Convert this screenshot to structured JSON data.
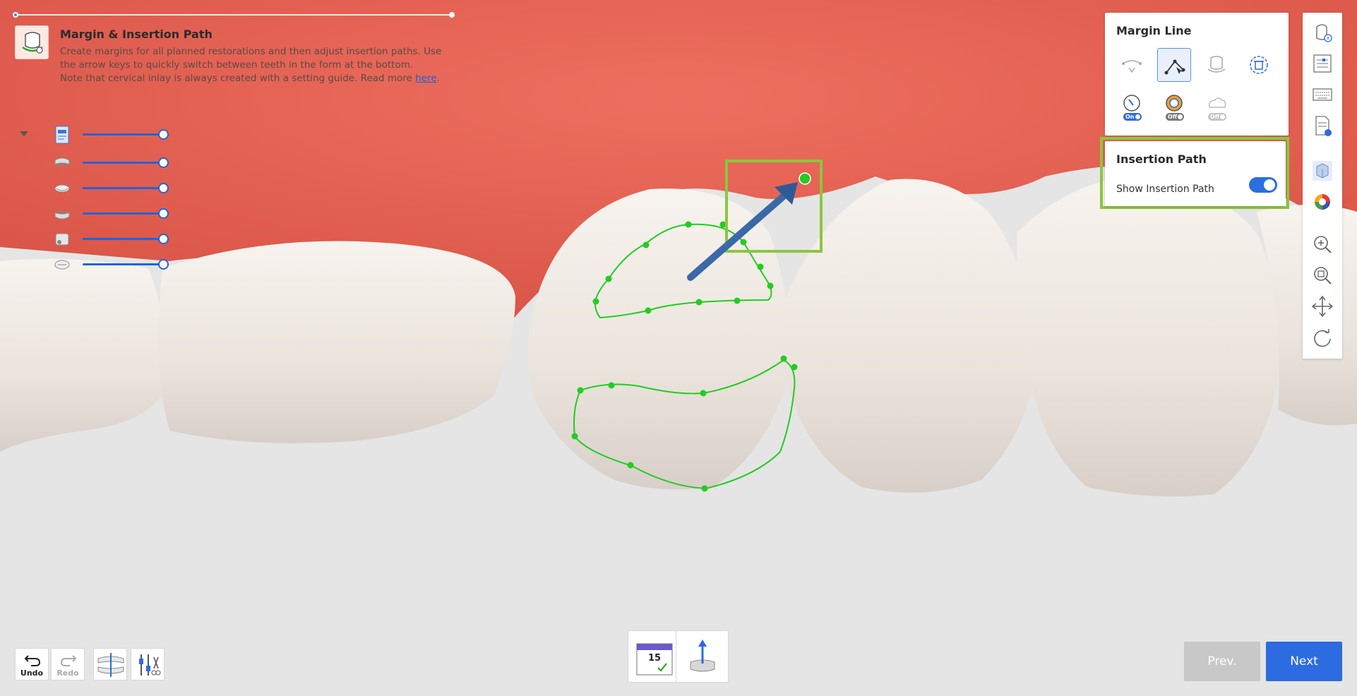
{
  "stage": {
    "title": "Margin & Insertion Path",
    "description_lines": [
      "Create margins for all planned restorations and then adjust insertion paths. Use",
      "the arrow keys to quickly switch between teeth in the form at the bottom.",
      "Note that cervical inlay is always created with a setting guide. Read more "
    ],
    "link_text": "here",
    "link_suffix": "."
  },
  "layers": {
    "count": 6,
    "opacity_values": [
      1,
      1,
      1,
      1,
      1,
      1
    ]
  },
  "margin_panel": {
    "title": "Margin Line",
    "tools": [
      {
        "icon": "point-margin-icon",
        "active": false,
        "disabled": true
      },
      {
        "icon": "draw-margin-icon",
        "active": true,
        "disabled": false
      },
      {
        "icon": "auto-margin-icon",
        "active": false,
        "disabled": true
      },
      {
        "icon": "delete-margin-icon",
        "active": false,
        "disabled": false
      },
      {
        "icon": "smart-detection-icon",
        "toggle": "On"
      },
      {
        "icon": "crosshair-icon",
        "toggle": "Off"
      },
      {
        "icon": "cloud-icon",
        "toggle": "Off"
      }
    ]
  },
  "insertion_panel": {
    "title": "Insertion Path",
    "show_label": "Show Insertion Path",
    "show_enabled": true
  },
  "right_toolbar": {
    "buttons": [
      "tooth-info-icon",
      "settings-sliders-icon",
      "keyboard-icon",
      "report-icon",
      "view-cube-icon",
      "color-wheel-icon",
      "zoom-in-icon",
      "zoom-fit-icon",
      "pan-icon",
      "rotate-icon"
    ]
  },
  "history": {
    "undo_label": "Undo",
    "redo_label": "Redo"
  },
  "tooth": {
    "number": "15"
  },
  "nav": {
    "prev_label": "Prev.",
    "next_label": "Next"
  },
  "colors": {
    "accent": "#2c6be0",
    "gingiva": "#e8695a",
    "tooth": "#efe9e3",
    "margin_line": "#22cc22",
    "highlight": "#8cc63f"
  }
}
